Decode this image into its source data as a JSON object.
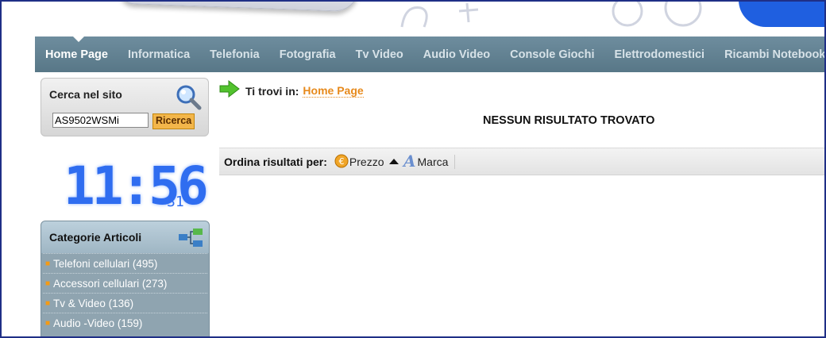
{
  "nav": {
    "items": [
      "Home Page",
      "Informatica",
      "Telefonia",
      "Fotografia",
      "Tv Video",
      "Audio Video",
      "Console Giochi",
      "Elettrodomestici",
      "Ricambi Notebook"
    ]
  },
  "search": {
    "title": "Cerca nel sito",
    "value": "AS9502WSMi",
    "button_label": "Ricerca"
  },
  "clock": {
    "time": "11:56",
    "seconds": "31"
  },
  "categories": {
    "title": "Categorie Articoli",
    "items": [
      "Telefoni cellulari (495)",
      "Accessori cellulari (273)",
      "Tv & Video (136)",
      "Audio -Video (159)"
    ]
  },
  "breadcrumb": {
    "label": "Ti trovi in:",
    "link": "Home Page"
  },
  "message": "NESSUN RISULTATO TROVATO",
  "sort": {
    "label": "Ordina risultati per:",
    "options": [
      "Prezzo",
      "Marca"
    ]
  },
  "colors": {
    "nav_bg": "#6e8d9e",
    "accent_orange": "#e78a1c",
    "frame": "#1f2f86"
  }
}
